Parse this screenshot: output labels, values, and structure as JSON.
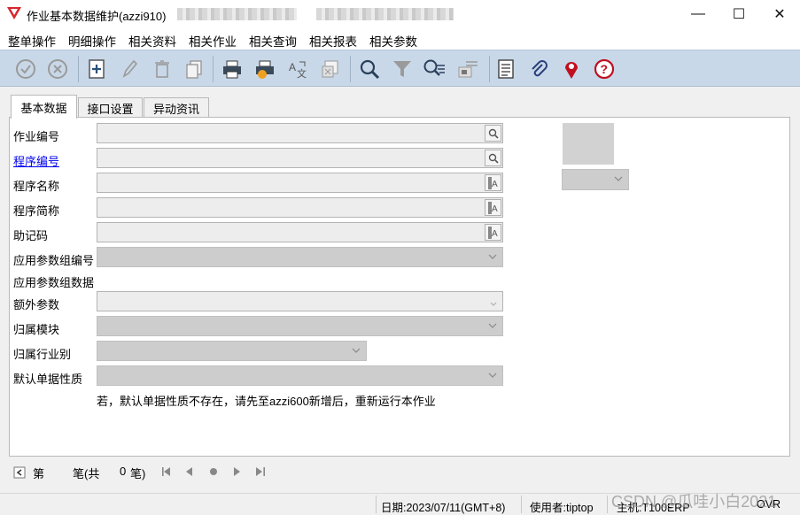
{
  "window": {
    "title": "作业基本数据维护(azzi910)",
    "controls": {
      "minimize": "—",
      "maximize": "☐",
      "close": "✕"
    }
  },
  "menu": [
    "整单操作",
    "明细操作",
    "相关资料",
    "相关作业",
    "相关查询",
    "相关报表",
    "相关参数"
  ],
  "toolbar": {
    "icons": [
      "confirm-icon",
      "cancel-icon",
      "add-icon",
      "edit-icon",
      "delete-icon",
      "copy-icon",
      "print-icon",
      "print-setup-icon",
      "translate-icon",
      "close-window-icon",
      "search-icon",
      "filter-icon",
      "advanced-search-icon",
      "export-icon",
      "report-list-icon",
      "attachment-icon",
      "location-icon",
      "help-icon"
    ]
  },
  "tabs": [
    "基本数据",
    "接口设置",
    "异动资讯"
  ],
  "form": {
    "job_no": "作业编号",
    "program_no": "程序编号",
    "program_name": "程序名称",
    "program_short": "程序简称",
    "mnemonic": "助记码",
    "param_group_no": "应用参数组编号",
    "param_group_data": "应用参数组数据",
    "extra_params": "额外参数",
    "module": "归属模块",
    "industry": "归属行业别",
    "default_doc_type": "默认单据性质",
    "note": "若，默认单据性质不存在，请先至azzi600新增后，重新运行本作业"
  },
  "nav": {
    "prefix": "第",
    "middle": "笔(共",
    "count": "0",
    "suffix": "笔)"
  },
  "status": {
    "date": "日期:2023/07/11(GMT+8)",
    "user": "使用者:tiptop",
    "host": "主机:T100ERP",
    "mode": "OVR"
  },
  "watermark": "CSDN @瓜哇小白2021",
  "colors": {
    "toolbar": "#c8d8e8",
    "link": "#0000ee",
    "field": "#ededed",
    "combo": "#cdcdcd"
  }
}
